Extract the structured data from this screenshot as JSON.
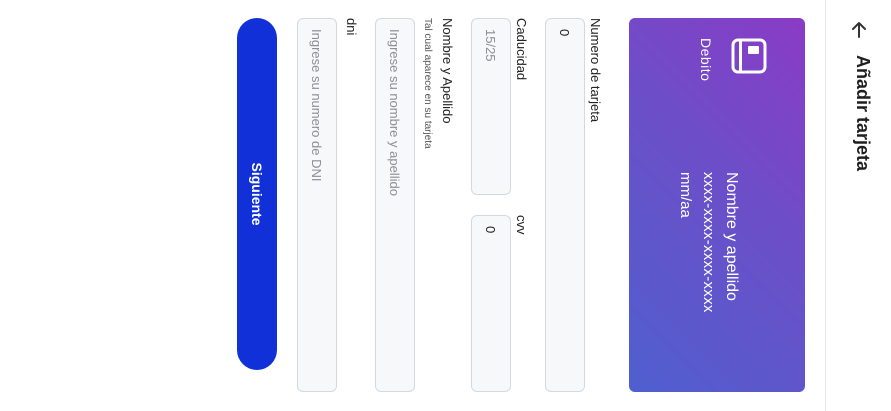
{
  "header": {
    "title": "Añadir tarjeta",
    "back_icon": "arrow-left-icon"
  },
  "card": {
    "type": "Debito",
    "icon": "credit-card-icon",
    "name": "Nombre y apellido",
    "number": "xxxx-xxxx-xxxx-xxxx",
    "expiry": "mm/aa",
    "gradient": [
      "#8a3bc6",
      "#4f5fcf"
    ]
  },
  "form": {
    "card_number": {
      "label": "Numero de tarjeta",
      "value": "0"
    },
    "expiry": {
      "label": "Caducidad",
      "placeholder": "15/25"
    },
    "cvv": {
      "label": "cvv",
      "value": "0"
    },
    "name": {
      "label": "Nombre y Apellido",
      "hint": "Tal cual aparece en su tarjeta",
      "placeholder": "Ingrese su nombre y apellido"
    },
    "dni": {
      "label": "dni",
      "placeholder": "Ingrese su numero de DNI"
    }
  },
  "button": {
    "label": "Siguiente",
    "color": "#1230d8"
  }
}
